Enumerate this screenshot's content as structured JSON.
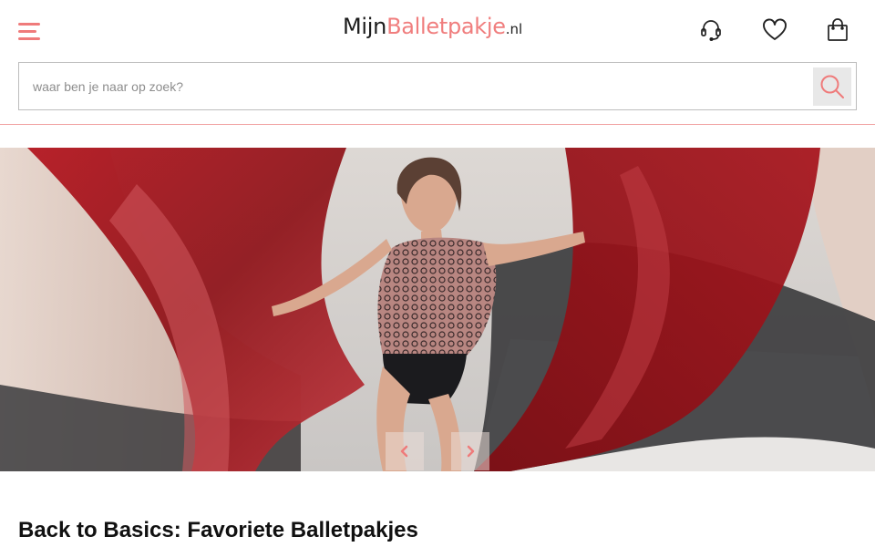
{
  "header": {
    "logo": {
      "part1": "Mijn",
      "part2": "Balletpakje",
      "part3": ".nl"
    },
    "icons": {
      "menu": "hamburger-menu-icon",
      "support": "headset-icon",
      "wishlist": "heart-icon",
      "cart": "shopping-bag-icon"
    }
  },
  "search": {
    "placeholder": "waar ben je naar op zoek?",
    "value": "",
    "icon": "search-icon"
  },
  "hero": {
    "image": "dancer-in-lace-leotard-with-red-and-black-drapes",
    "prev_icon": "chevron-left-icon",
    "next_icon": "chevron-right-icon"
  },
  "content": {
    "section_title": "Back to Basics: Favoriete Balletpakjes"
  },
  "colors": {
    "accent": "#ef7b7b",
    "logo_text": "#1d1d1d",
    "border": "#bdbdbd"
  }
}
